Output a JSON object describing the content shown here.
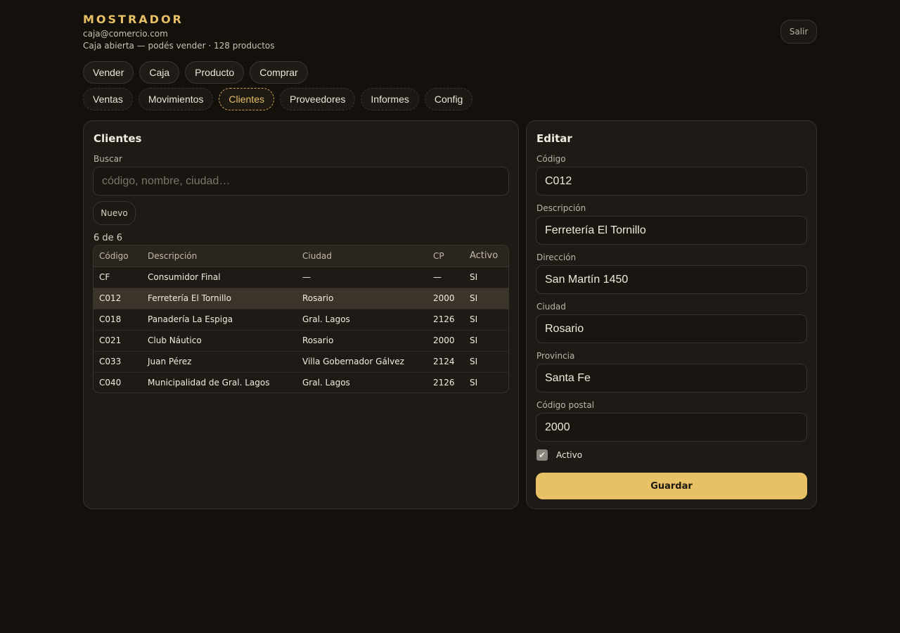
{
  "header": {
    "brand": "MOSTRADOR",
    "user_email": "caja@comercio.com",
    "status": "Caja abierta — podés vender · 128 productos",
    "logout_label": "Salir"
  },
  "nav_primary": [
    {
      "label": "Vender"
    },
    {
      "label": "Caja"
    },
    {
      "label": "Producto"
    },
    {
      "label": "Comprar"
    }
  ],
  "nav_secondary": [
    {
      "label": "Ventas",
      "active": false
    },
    {
      "label": "Movimientos",
      "active": false
    },
    {
      "label": "Clientes",
      "active": true
    },
    {
      "label": "Proveedores",
      "active": false
    },
    {
      "label": "Informes",
      "active": false
    },
    {
      "label": "Config",
      "active": false
    }
  ],
  "clients_panel": {
    "title": "Clientes",
    "search_label": "Buscar",
    "search_placeholder": "código, nombre, ciudad…",
    "search_value": "",
    "new_button": "Nuevo",
    "count_text": "6 de 6",
    "columns": [
      "Código",
      "Descripción",
      "Ciudad",
      "CP",
      "Activo"
    ],
    "rows": [
      {
        "codigo": "CF",
        "descripcion": "Consumidor Final",
        "ciudad": "—",
        "cp": "—",
        "activo": "SI",
        "selected": false
      },
      {
        "codigo": "C012",
        "descripcion": "Ferretería El Tornillo",
        "ciudad": "Rosario",
        "cp": "2000",
        "activo": "SI",
        "selected": true
      },
      {
        "codigo": "C018",
        "descripcion": "Panadería La Espiga",
        "ciudad": "Gral. Lagos",
        "cp": "2126",
        "activo": "SI",
        "selected": false
      },
      {
        "codigo": "C021",
        "descripcion": "Club Náutico",
        "ciudad": "Rosario",
        "cp": "2000",
        "activo": "SI",
        "selected": false
      },
      {
        "codigo": "C033",
        "descripcion": "Juan Pérez",
        "ciudad": "Villa Gobernador Gálvez",
        "cp": "2124",
        "activo": "SI",
        "selected": false
      },
      {
        "codigo": "C040",
        "descripcion": "Municipalidad de Gral. Lagos",
        "ciudad": "Gral. Lagos",
        "cp": "2126",
        "activo": "SI",
        "selected": false
      }
    ]
  },
  "edit_panel": {
    "title": "Editar",
    "fields": {
      "codigo": {
        "label": "Código",
        "value": "C012"
      },
      "descripcion": {
        "label": "Descripción",
        "value": "Ferretería El Tornillo"
      },
      "direccion": {
        "label": "Dirección",
        "value": "San Martín 1450"
      },
      "ciudad": {
        "label": "Ciudad",
        "value": "Rosario"
      },
      "provincia": {
        "label": "Provincia",
        "value": "Santa Fe"
      },
      "codigo_postal": {
        "label": "Código postal",
        "value": "2000"
      }
    },
    "activo_label": "Activo",
    "activo_checked": true,
    "save_label": "Guardar"
  },
  "colors": {
    "background": "#14110d",
    "panel": "#1e1b16",
    "accent": "#e8c066",
    "selected_row": "#3b342a"
  }
}
